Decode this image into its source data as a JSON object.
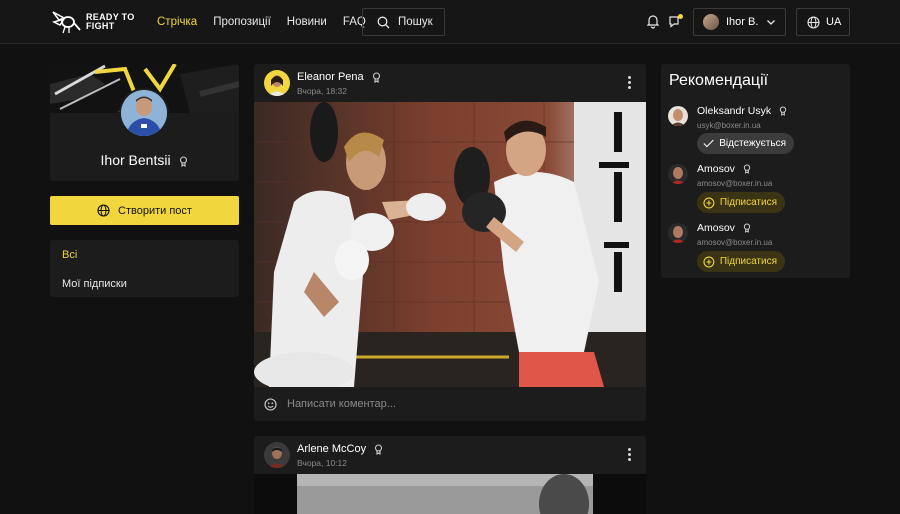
{
  "header": {
    "logo_text_line1": "READY TO",
    "logo_text_line2": "FIGHT",
    "nav": [
      {
        "label": "Стрічка",
        "active": true
      },
      {
        "label": "Пропозиції",
        "active": false
      },
      {
        "label": "Новини",
        "active": false
      },
      {
        "label": "FAQ",
        "active": false
      }
    ],
    "search_label": "Пошук",
    "user_name": "Ihor B.",
    "language": "UA"
  },
  "profile": {
    "name": "Ihor Bentsii",
    "create_post_label": "Створити пост",
    "filters": [
      {
        "label": "Всі",
        "active": true
      },
      {
        "label": "Мої підписки",
        "active": false
      }
    ]
  },
  "feed": {
    "posts": [
      {
        "author": "Eleanor Pena",
        "time": "Вчора, 18:32",
        "comment_placeholder": "Написати коментар..."
      },
      {
        "author": "Arlene McCoy",
        "time": "Вчора, 10:12"
      }
    ]
  },
  "recommendations": {
    "title": "Рекомендації",
    "items": [
      {
        "name": "Oleksandr Usyk",
        "email": "usyk@boxer.in.ua",
        "button": "Відстежується",
        "state": "following"
      },
      {
        "name": "Amosov",
        "email": "amosov@boxer.in.ua",
        "button": "Підписатися",
        "state": "subscribe"
      },
      {
        "name": "Amosov",
        "email": "amosov@boxer.in.ua",
        "button": "Підписатися",
        "state": "subscribe"
      }
    ]
  },
  "colors": {
    "accent": "#f2d63d",
    "background": "#111111",
    "card": "#1c1c1c"
  },
  "icons": [
    "wasp-logo-icon",
    "search-icon",
    "bell-icon",
    "chat-notification-icon",
    "chevron-down-icon",
    "globe-icon",
    "award-icon",
    "more-vertical-icon",
    "smile-icon",
    "check-icon",
    "plus-circle-icon"
  ]
}
